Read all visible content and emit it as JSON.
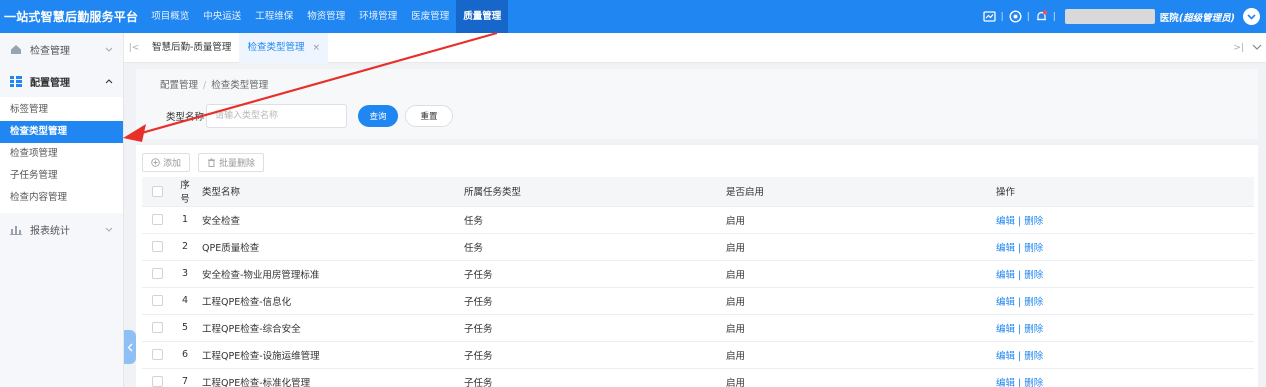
{
  "app": {
    "title": "一站式智慧后勤服务平台"
  },
  "topnav": [
    {
      "label": "项目概览"
    },
    {
      "label": "中央运送"
    },
    {
      "label": "工程维保"
    },
    {
      "label": "物资管理"
    },
    {
      "label": "环境管理"
    },
    {
      "label": "医废管理"
    },
    {
      "label": "质量管理",
      "active": true
    }
  ],
  "header": {
    "hospital": "医院",
    "role": "(超级管理员)",
    "separator": "|"
  },
  "sidebar": {
    "groups": [
      {
        "label": "检查管理",
        "icon": "home-icon"
      },
      {
        "label": "配置管理",
        "icon": "grid-icon",
        "items": [
          {
            "label": "标签管理"
          },
          {
            "label": "检查类型管理",
            "active": true
          },
          {
            "label": "检查项管理"
          },
          {
            "label": "子任务管理"
          },
          {
            "label": "检查内容管理"
          }
        ]
      },
      {
        "label": "报表统计",
        "icon": "bar-chart-icon"
      }
    ]
  },
  "tabs": [
    {
      "label": "智慧后勤-质量管理"
    },
    {
      "label": "检查类型管理",
      "active": true,
      "close": "×"
    }
  ],
  "breadcrumb": {
    "parent": "配置管理",
    "separator": "/",
    "current": "检查类型管理"
  },
  "search": {
    "label": "类型名称",
    "placeholder": "请输入类型名称",
    "query_button": "查询",
    "reset_button": "重置"
  },
  "toolbar": {
    "add_label": "添加",
    "batch_delete_label": "批量删除"
  },
  "table": {
    "columns": [
      "序号",
      "类型名称",
      "所属任务类型",
      "是否启用",
      "操作"
    ],
    "rows": [
      {
        "index": "1",
        "name": "安全检查",
        "task_type": "任务",
        "enabled": "启用",
        "edit": "编辑",
        "delete": "删除"
      },
      {
        "index": "2",
        "name": "QPE质量检查",
        "task_type": "任务",
        "enabled": "启用",
        "edit": "编辑",
        "delete": "删除"
      },
      {
        "index": "3",
        "name": "安全检查-物业用房管理标准",
        "task_type": "子任务",
        "enabled": "启用",
        "edit": "编辑",
        "delete": "删除"
      },
      {
        "index": "4",
        "name": "工程QPE检查-信息化",
        "task_type": "子任务",
        "enabled": "启用",
        "edit": "编辑",
        "delete": "删除"
      },
      {
        "index": "5",
        "name": "工程QPE检查-综合安全",
        "task_type": "子任务",
        "enabled": "启用",
        "edit": "编辑",
        "delete": "删除"
      },
      {
        "index": "6",
        "name": "工程QPE检查-设施运维管理",
        "task_type": "子任务",
        "enabled": "启用",
        "edit": "编辑",
        "delete": "删除"
      },
      {
        "index": "7",
        "name": "工程QPE检查-标准化管理",
        "task_type": "子任务",
        "enabled": "启用",
        "edit": "编辑",
        "delete": "删除"
      }
    ],
    "op_separator": "|"
  },
  "colors": {
    "primary": "#1f86f2",
    "nav_active": "#1766c9",
    "annotation_arrow": "#e8302a"
  }
}
